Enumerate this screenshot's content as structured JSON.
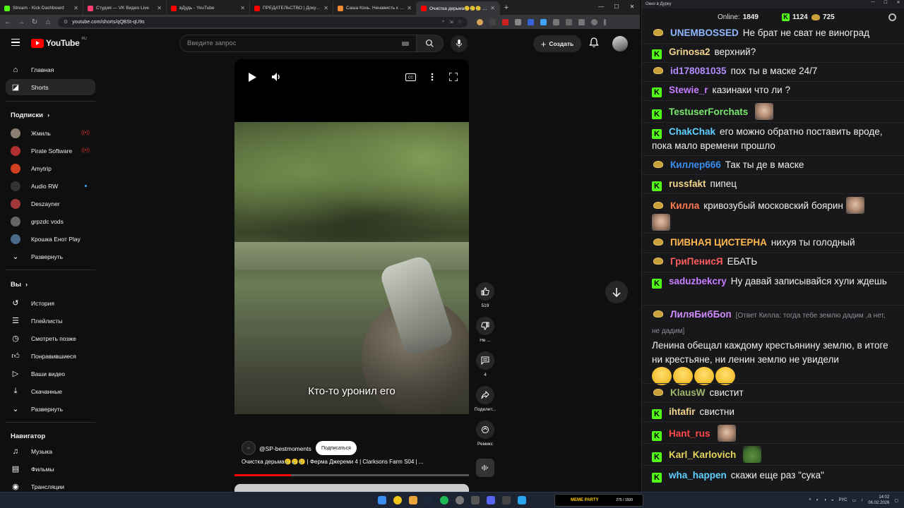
{
  "browser": {
    "tabs": [
      {
        "title": "Stream - Kick Dashboard",
        "color": "#53fc18",
        "active": false
      },
      {
        "title": "Студия — VK Видео Live",
        "color": "#ff3c6e",
        "active": false
      },
      {
        "title": "вДудь - YouTube",
        "color": "#ff0000",
        "active": false
      },
      {
        "title": "ПРЕДАТЕЛЬСТВО | Документал",
        "color": "#ff0000",
        "active": false
      },
      {
        "title": "Саша Конь. Ненависть к Стасу",
        "color": "#f28b30",
        "active": false
      },
      {
        "title": "Очистка дерьма🥲🥲🥲 | Фе",
        "color": "#ff0000",
        "active": true
      }
    ],
    "url": "youtube.com/shorts/qQBSt-qU9s"
  },
  "youtube": {
    "logo_text": "YouTube",
    "country_code": "RU",
    "search_placeholder": "Введите запрос",
    "create_label": "Создать",
    "sidebar": {
      "main": [
        {
          "label": "Главная",
          "icon": "home-icon"
        },
        {
          "label": "Shorts",
          "icon": "shorts-icon",
          "active": true
        }
      ],
      "subscriptions_title": "Подписки",
      "subscriptions": [
        {
          "label": "Жмиль",
          "live": true,
          "color": "#8a7f70"
        },
        {
          "label": "Pirate Software",
          "live": true,
          "color": "#b03030"
        },
        {
          "label": "Amytrip",
          "live": false,
          "color": "#d04020"
        },
        {
          "label": "Audio RW",
          "live": false,
          "dot": true,
          "color": "#333"
        },
        {
          "label": "Deszayner",
          "live": false,
          "color": "#a03a3a"
        },
        {
          "label": "grpzdc vods",
          "live": false,
          "color": "#666"
        },
        {
          "label": "Крошка Енот Play",
          "live": false,
          "color": "#4a6a8a"
        }
      ],
      "expand1": "Развернуть",
      "you_title": "Вы",
      "you": [
        {
          "label": "История",
          "icon": "history-icon"
        },
        {
          "label": "Плейлисты",
          "icon": "playlists-icon"
        },
        {
          "label": "Смотреть позже",
          "icon": "watch-later-icon"
        },
        {
          "label": "Понравившиеся",
          "icon": "liked-icon"
        },
        {
          "label": "Ваши видео",
          "icon": "your-videos-icon"
        },
        {
          "label": "Скачанные",
          "icon": "downloads-icon"
        }
      ],
      "expand2": "Развернуть",
      "navigator_title": "Навигатор",
      "navigator": [
        {
          "label": "Музыка",
          "icon": "music-icon"
        },
        {
          "label": "Фильмы",
          "icon": "movies-icon"
        },
        {
          "label": "Трансляции",
          "icon": "live-icon"
        }
      ]
    },
    "short": {
      "subtitle": "Кто-то уронил его",
      "channel": "@SP-bestmoments",
      "subscribe_label": "Подписаться",
      "title": "Очистка дерьма🥲🥲🥲 | Ферма Джереми 4 | Clarksons Farm S04 | ...",
      "progress": 0.24,
      "likes": "519",
      "dislike_label": "Не ...",
      "comments": "4",
      "share_label": "Поделит...",
      "remix_label": "Ремикс"
    }
  },
  "chat": {
    "window_title": "Окно в Дурку",
    "online_label": "Online:",
    "online": "1849",
    "kick_count": "1124",
    "other_count": "725",
    "messages": [
      {
        "badge": "h",
        "nick": "UNEMBOSSED",
        "color": "#8fb8ff",
        "text": "Не брат не сват не виноград"
      },
      {
        "badge": "k",
        "nick": "Grinosa2",
        "color": "#f2d48a",
        "text": "верхний?"
      },
      {
        "badge": "h",
        "nick": "id178081035",
        "color": "#b58cff",
        "text": "пох ты в маске 24/7"
      },
      {
        "badge": "k",
        "nick": "Stewie_r",
        "color": "#c77dff",
        "text": "казинаки что ли ?"
      },
      {
        "badge": "k",
        "nick": "TestuserForchats",
        "color": "#79e86b",
        "text": "",
        "emote": "face"
      },
      {
        "badge": "k",
        "nick": "ChakChak",
        "color": "#5fd0ff",
        "text": "его можно обратно поставить вроде, пока мало времени прошло"
      },
      {
        "badge": "h",
        "nick": "Киллер666",
        "color": "#3a8ef0",
        "text": "Так ты де в маске"
      },
      {
        "badge": "k",
        "nick": "russfakt",
        "color": "#f2d48a",
        "text": "пипец"
      },
      {
        "badge": "h",
        "nick": "Килла",
        "color": "#ff7a4f",
        "text": "кривозубый московский боярин"
      },
      {
        "badge": "h",
        "nick": "ПИВНАЯ ЦИСТЕРНА",
        "color": "#ffb84d",
        "text": "нихуя ты голодный"
      },
      {
        "badge": "h",
        "nick": "ГриПенисЯ",
        "color": "#ff5e5e",
        "text": "ЕБАТЬ"
      },
      {
        "badge": "k",
        "nick": "saduzbekcry",
        "color": "#c77dff",
        "text": "Ну давай записывайся хули ждешь"
      },
      {
        "badge": "h",
        "nick": "ЛиляБибБоп",
        "color": "#d28cff",
        "reply": "[Ответ Килла: тогда тебе землю дадим ,а нет, не дадим]",
        "text": "Ленина обещал каждому крестьянину землю, в итоге ни крестьяне, ни ленин землю не увидели"
      },
      {
        "badge": "h",
        "nick": "KlausW",
        "color": "#9db86a",
        "text": "свистит"
      },
      {
        "badge": "k",
        "nick": "ihtafir",
        "color": "#f2d48a",
        "text": "свистни"
      },
      {
        "badge": "k",
        "nick": "Hant_rus",
        "color": "#ff4747",
        "text": "",
        "emote": "face"
      },
      {
        "badge": "k",
        "nick": "Karl_Karlovich",
        "color": "#e6d55a",
        "text": "",
        "emote": "frog"
      },
      {
        "badge": "k",
        "nick": "wha_happen",
        "color": "#5fd0ff",
        "text": "скажи еще раз \"сука\""
      }
    ]
  },
  "taskbar": {
    "media_title": "MEME PARTY",
    "media_counter": "275 / 1500",
    "lang": "РУС",
    "time": "14:02",
    "date": "06.02.2026"
  }
}
